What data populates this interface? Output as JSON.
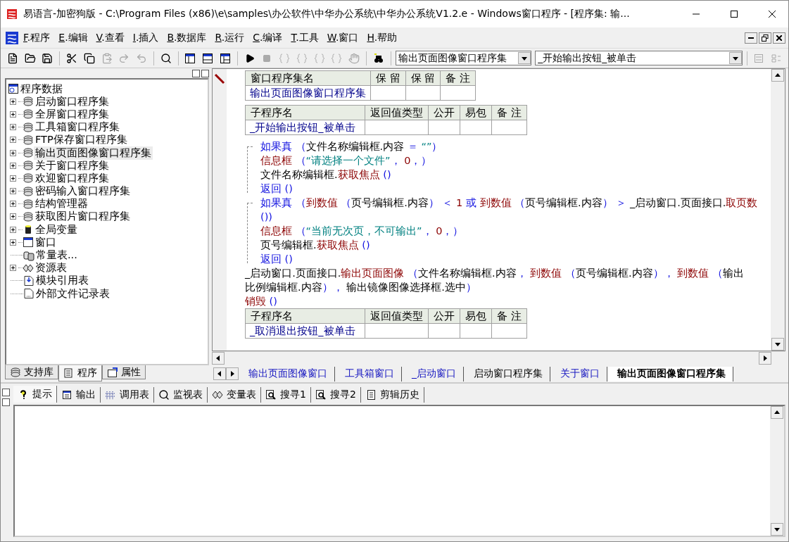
{
  "window": {
    "title": "易语言-加密狗版 - C:\\Program Files (x86)\\e\\samples\\办公软件\\中华办公系统\\中华办公系统V1.2.e - Windows窗口程序 - [程序集: 输..."
  },
  "menu": [
    "F.程序",
    "E.编辑",
    "V.查看",
    "I.插入",
    "B.数据库",
    "R.运行",
    "C.编译",
    "T.工具",
    "W.窗口",
    "H.帮助"
  ],
  "toolbar": {
    "set_combo": "输出页面图像窗口程序集",
    "method_combo": "_开始输出按钮_被单击"
  },
  "tree": {
    "root": "程序数据",
    "items": [
      {
        "label": "启动窗口程序集",
        "kind": "set",
        "expandable": true,
        "selected": false
      },
      {
        "label": "全屏窗口程序集",
        "kind": "set",
        "expandable": true,
        "selected": false
      },
      {
        "label": "工具箱窗口程序集",
        "kind": "set",
        "expandable": true,
        "selected": false
      },
      {
        "label": "FTP保存窗口程序集",
        "kind": "set",
        "expandable": true,
        "selected": false
      },
      {
        "label": "输出页面图像窗口程序集",
        "kind": "set",
        "expandable": true,
        "selected": true
      },
      {
        "label": "关于窗口程序集",
        "kind": "set",
        "expandable": true,
        "selected": false
      },
      {
        "label": "欢迎窗口程序集",
        "kind": "set",
        "expandable": true,
        "selected": false
      },
      {
        "label": "密码输入窗口程序集",
        "kind": "set",
        "expandable": true,
        "selected": false
      },
      {
        "label": "结构管理器",
        "kind": "set",
        "expandable": true,
        "selected": false
      },
      {
        "label": "获取图片窗口程序集",
        "kind": "set",
        "expandable": true,
        "selected": false
      },
      {
        "label": "全局变量",
        "kind": "globals",
        "expandable": true,
        "selected": false
      },
      {
        "label": "窗口",
        "kind": "window",
        "expandable": true,
        "selected": false
      },
      {
        "label": "常量表...",
        "kind": "constants",
        "expandable": false,
        "selected": false
      },
      {
        "label": "资源表",
        "kind": "resources",
        "expandable": true,
        "selected": false
      },
      {
        "label": "模块引用表",
        "kind": "modules",
        "expandable": false,
        "selected": false
      },
      {
        "label": "外部文件记录表",
        "kind": "files",
        "expandable": false,
        "selected": false
      }
    ]
  },
  "left_tabs": [
    {
      "label": "支持库",
      "kind": "library",
      "selected": false
    },
    {
      "label": "程序",
      "kind": "program",
      "selected": true
    },
    {
      "label": "属性",
      "kind": "properties",
      "selected": false
    }
  ],
  "editor": {
    "blocks": [
      {
        "kind": "table",
        "columns": [
          "窗口程序集名",
          "保 留",
          "保 留",
          "备 注"
        ],
        "rows": [
          [
            "输出页面图像窗口程序集",
            "",
            "",
            ""
          ]
        ]
      },
      {
        "kind": "table",
        "columns": [
          "子程序名",
          "返回值类型",
          "公开",
          "易包",
          "备 注"
        ],
        "rows": [
          [
            "_开始输出按钮_被单击",
            "",
            "",
            "",
            ""
          ]
        ]
      },
      {
        "kind": "if",
        "head": [
          {
            "kind": "kw",
            "text": "如果真"
          },
          {
            "kind": "op",
            "text": " （"
          },
          {
            "kind": "txt",
            "text": "文件名称编辑框.内容"
          },
          {
            "kind": "op",
            "text": " ＝ "
          },
          {
            "kind": "str",
            "text": "“”"
          },
          {
            "kind": "op",
            "text": "）"
          }
        ],
        "body": [
          [
            {
              "kind": "fn",
              "text": "信息框"
            },
            {
              "kind": "op",
              "text": " （"
            },
            {
              "kind": "str",
              "text": "“请选择一个文件”"
            },
            {
              "kind": "op",
              "text": "，"
            },
            {
              "kind": "num",
              "text": " 0"
            },
            {
              "kind": "op",
              "text": "，）"
            }
          ],
          [
            {
              "kind": "txt",
              "text": "文件名称编辑框."
            },
            {
              "kind": "fn",
              "text": "获取焦点"
            },
            {
              "kind": "op",
              "text": " ()"
            }
          ],
          [
            {
              "kind": "kw",
              "text": "返回"
            },
            {
              "kind": "op",
              "text": " ()"
            }
          ]
        ]
      },
      {
        "kind": "if",
        "head": [
          {
            "kind": "kw",
            "text": "如果真"
          },
          {
            "kind": "op",
            "text": " （"
          },
          {
            "kind": "fn",
            "text": "到数值"
          },
          {
            "kind": "op",
            "text": " （"
          },
          {
            "kind": "txt",
            "text": "页号编辑框.内容"
          },
          {
            "kind": "op",
            "text": "） ＜ "
          },
          {
            "kind": "num",
            "text": "1"
          },
          {
            "kind": "kw",
            "text": " 或 "
          },
          {
            "kind": "fn",
            "text": "到数值"
          },
          {
            "kind": "op",
            "text": " （"
          },
          {
            "kind": "txt",
            "text": "页号编辑框.内容"
          },
          {
            "kind": "op",
            "text": "） ＞ "
          },
          {
            "kind": "txt",
            "text": "_启动窗口.页面接口."
          },
          {
            "kind": "fn",
            "text": "取页数"
          },
          {
            "kind": "op",
            "text": " ())"
          }
        ],
        "body": [
          [
            {
              "kind": "fn",
              "text": "信息框"
            },
            {
              "kind": "op",
              "text": " （"
            },
            {
              "kind": "str",
              "text": "“当前无次页，不可输出”"
            },
            {
              "kind": "op",
              "text": "，"
            },
            {
              "kind": "num",
              "text": " 0"
            },
            {
              "kind": "op",
              "text": "，）"
            }
          ],
          [
            {
              "kind": "txt",
              "text": "页号编辑框."
            },
            {
              "kind": "fn",
              "text": "获取焦点"
            },
            {
              "kind": "op",
              "text": " ()"
            }
          ],
          [
            {
              "kind": "kw",
              "text": "返回"
            },
            {
              "kind": "op",
              "text": " ()"
            }
          ]
        ]
      },
      {
        "kind": "line",
        "segments": [
          {
            "kind": "txt",
            "text": "_启动窗口.页面接口."
          },
          {
            "kind": "fn",
            "text": "输出页面图像"
          },
          {
            "kind": "op",
            "text": " （"
          },
          {
            "kind": "txt",
            "text": "文件名称编辑框.内容"
          },
          {
            "kind": "op",
            "text": "，"
          },
          {
            "kind": "fn",
            "text": " 到数值"
          },
          {
            "kind": "op",
            "text": " （"
          },
          {
            "kind": "txt",
            "text": "页号编辑框.内容"
          },
          {
            "kind": "op",
            "text": "），"
          },
          {
            "kind": "fn",
            "text": " 到数值"
          },
          {
            "kind": "op",
            "text": " （"
          },
          {
            "kind": "txt",
            "text": "输出比例编辑框.内容"
          },
          {
            "kind": "op",
            "text": "），"
          },
          {
            "kind": "txt",
            "text": " 输出镜像图像选择框.选中"
          },
          {
            "kind": "op",
            "text": "）"
          }
        ]
      },
      {
        "kind": "line",
        "segments": [
          {
            "kind": "fn",
            "text": "销毁"
          },
          {
            "kind": "op",
            "text": " ()"
          }
        ]
      },
      {
        "kind": "table",
        "columns": [
          "子程序名",
          "返回值类型",
          "公开",
          "易包",
          "备 注"
        ],
        "rows": [
          [
            "_取消退出按钮_被单击",
            "",
            "",
            "",
            ""
          ]
        ]
      }
    ]
  },
  "doc_tabs": [
    {
      "label": "输出页面图像窗口",
      "kind": "window",
      "selected": false
    },
    {
      "label": "工具箱窗口",
      "kind": "window",
      "selected": false
    },
    {
      "label": "_启动窗口",
      "kind": "window",
      "selected": false
    },
    {
      "label": "启动窗口程序集",
      "kind": "set",
      "selected": false
    },
    {
      "label": "关于窗口",
      "kind": "window",
      "selected": false
    },
    {
      "label": "输出页面图像窗口程序集",
      "kind": "set",
      "selected": true
    }
  ],
  "bottom_tabs": [
    {
      "label": "提示",
      "kind": "hint",
      "selected": true
    },
    {
      "label": "输出",
      "kind": "output",
      "selected": false
    },
    {
      "label": "调用表",
      "kind": "calls",
      "selected": false
    },
    {
      "label": "监视表",
      "kind": "watch",
      "selected": false
    },
    {
      "label": "变量表",
      "kind": "variables",
      "selected": false
    },
    {
      "label": "搜寻1",
      "kind": "search",
      "selected": false
    },
    {
      "label": "搜寻2",
      "kind": "search",
      "selected": false
    },
    {
      "label": "剪辑历史",
      "kind": "clips",
      "selected": false
    }
  ]
}
